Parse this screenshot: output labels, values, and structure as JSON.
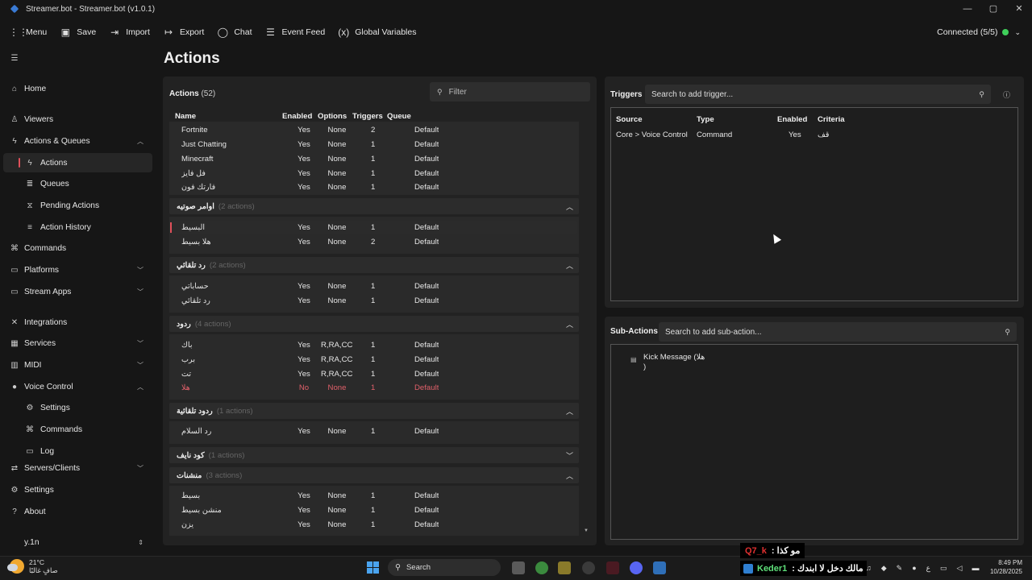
{
  "window": {
    "title": "Streamer.bot - Streamer.bot (v1.0.1)",
    "minimize": "—",
    "maximize": "▢",
    "close": "✕"
  },
  "toolbar": {
    "menu": "Menu",
    "save": "Save",
    "import": "Import",
    "export": "Export",
    "chat": "Chat",
    "event_feed": "Event Feed",
    "global_variables": "Global Variables",
    "connected": "Connected (5/5)",
    "connected_color": "#3fcf5a"
  },
  "sidebar": {
    "items": [
      {
        "label": "Home",
        "icon": "home-icon"
      },
      {
        "label": "Viewers",
        "icon": "user-icon"
      },
      {
        "label": "Actions & Queues",
        "icon": "bolt-icon"
      },
      {
        "label": "Actions",
        "icon": "bolt-icon"
      },
      {
        "label": "Queues",
        "icon": "stack-icon"
      },
      {
        "label": "Pending Actions",
        "icon": "pending-icon"
      },
      {
        "label": "Action History",
        "icon": "history-icon"
      },
      {
        "label": "Commands",
        "icon": "command-icon"
      },
      {
        "label": "Platforms",
        "icon": "platforms-icon"
      },
      {
        "label": "Stream Apps",
        "icon": "stream-apps-icon"
      },
      {
        "label": "Integrations",
        "icon": "integrations-icon"
      },
      {
        "label": "Services",
        "icon": "services-icon"
      },
      {
        "label": "MIDI",
        "icon": "midi-icon"
      },
      {
        "label": "Voice Control",
        "icon": "microphone-icon"
      },
      {
        "label": "Settings",
        "icon": "gear-icon"
      },
      {
        "label": "Commands",
        "icon": "command-icon"
      },
      {
        "label": "Log",
        "icon": "log-icon"
      },
      {
        "label": "Servers/Clients",
        "icon": "server-icon"
      },
      {
        "label": "Settings",
        "icon": "gear-icon"
      },
      {
        "label": "About",
        "icon": "question-icon"
      }
    ],
    "profile": "y.1n"
  },
  "page_title": "Actions",
  "actions": {
    "title": "Actions",
    "count": "(52)",
    "filter_placeholder": "Filter",
    "columns": {
      "name": "Name",
      "enabled": "Enabled",
      "options": "Options",
      "triggers": "Triggers",
      "queue": "Queue"
    },
    "top_rows": [
      {
        "name": "Fortnite",
        "enabled": "Yes",
        "options": "None",
        "triggers": "2",
        "queue": "Default"
      },
      {
        "name": "Just Chatting",
        "enabled": "Yes",
        "options": "None",
        "triggers": "1",
        "queue": "Default"
      },
      {
        "name": "Minecraft",
        "enabled": "Yes",
        "options": "None",
        "triggers": "1",
        "queue": "Default"
      },
      {
        "name": "فل فايز",
        "enabled": "Yes",
        "options": "None",
        "triggers": "1",
        "queue": "Default"
      },
      {
        "name": "فارتك فون",
        "enabled": "Yes",
        "options": "None",
        "triggers": "1",
        "queue": "Default"
      }
    ],
    "groups": [
      {
        "name": "اوامر صوتيه",
        "count": "(2 actions)",
        "rows": [
          {
            "name": "البسيط",
            "enabled": "Yes",
            "options": "None",
            "triggers": "1",
            "queue": "Default"
          },
          {
            "name": "هلا بسيط",
            "enabled": "Yes",
            "options": "None",
            "triggers": "2",
            "queue": "Default"
          }
        ]
      },
      {
        "name": "رد تلقائي",
        "count": "(2 actions)",
        "rows": [
          {
            "name": "حساباتي",
            "enabled": "Yes",
            "options": "None",
            "triggers": "1",
            "queue": "Default"
          },
          {
            "name": "رد تلقائي",
            "enabled": "Yes",
            "options": "None",
            "triggers": "1",
            "queue": "Default"
          }
        ]
      },
      {
        "name": "ردود",
        "count": "(4 actions)",
        "rows": [
          {
            "name": "باك",
            "enabled": "Yes",
            "options": "R,RA,CC,E",
            "triggers": "1",
            "queue": "Default"
          },
          {
            "name": "برب",
            "enabled": "Yes",
            "options": "R,RA,CC,E",
            "triggers": "1",
            "queue": "Default"
          },
          {
            "name": "تت",
            "enabled": "Yes",
            "options": "R,RA,CC,E",
            "triggers": "1",
            "queue": "Default"
          },
          {
            "name": "هلا",
            "enabled": "No",
            "options": "None",
            "triggers": "1",
            "queue": "Default"
          }
        ]
      },
      {
        "name": "ردود تلقائية",
        "count": "(1 actions)",
        "rows": [
          {
            "name": "رد السلام",
            "enabled": "Yes",
            "options": "None",
            "triggers": "1",
            "queue": "Default"
          }
        ]
      },
      {
        "name": "كود نايف",
        "count": "(1 actions)",
        "rows": []
      },
      {
        "name": "منشنات",
        "count": "(3 actions)",
        "rows": [
          {
            "name": "بسيط",
            "enabled": "Yes",
            "options": "None",
            "triggers": "1",
            "queue": "Default"
          },
          {
            "name": "منشن بسيط",
            "enabled": "Yes",
            "options": "None",
            "triggers": "1",
            "queue": "Default"
          },
          {
            "name": "يزن",
            "enabled": "Yes",
            "options": "None",
            "triggers": "1",
            "queue": "Default"
          }
        ]
      }
    ],
    "disabled_color": "#e0606a",
    "selected_accent": "#e0505a"
  },
  "triggers": {
    "title": "Triggers",
    "search_placeholder": "Search to add trigger...",
    "columns": {
      "source": "Source",
      "type": "Type",
      "enabled": "Enabled",
      "criteria": "Criteria"
    },
    "rows": [
      {
        "source": "Core > Voice Control",
        "type": "Command",
        "enabled": "Yes",
        "criteria": "قف"
      }
    ]
  },
  "sub_actions": {
    "title": "Sub-Actions",
    "search_placeholder": "Search to add sub-action...",
    "items": [
      {
        "line1": "Kick Message (هلا",
        "line2": ")"
      }
    ]
  },
  "taskbar": {
    "weather_temp": "21°C",
    "weather_desc": "صافٍ غالبًا",
    "search": "Search",
    "time": "8:49 PM",
    "date": "10/28/2025"
  },
  "chat_overlay": {
    "line1_user": "Q7_k",
    "line1_text": ": مو كذا",
    "line2_user": "Keder1",
    "line2_text": ": مالك دخل لا ابندك"
  }
}
